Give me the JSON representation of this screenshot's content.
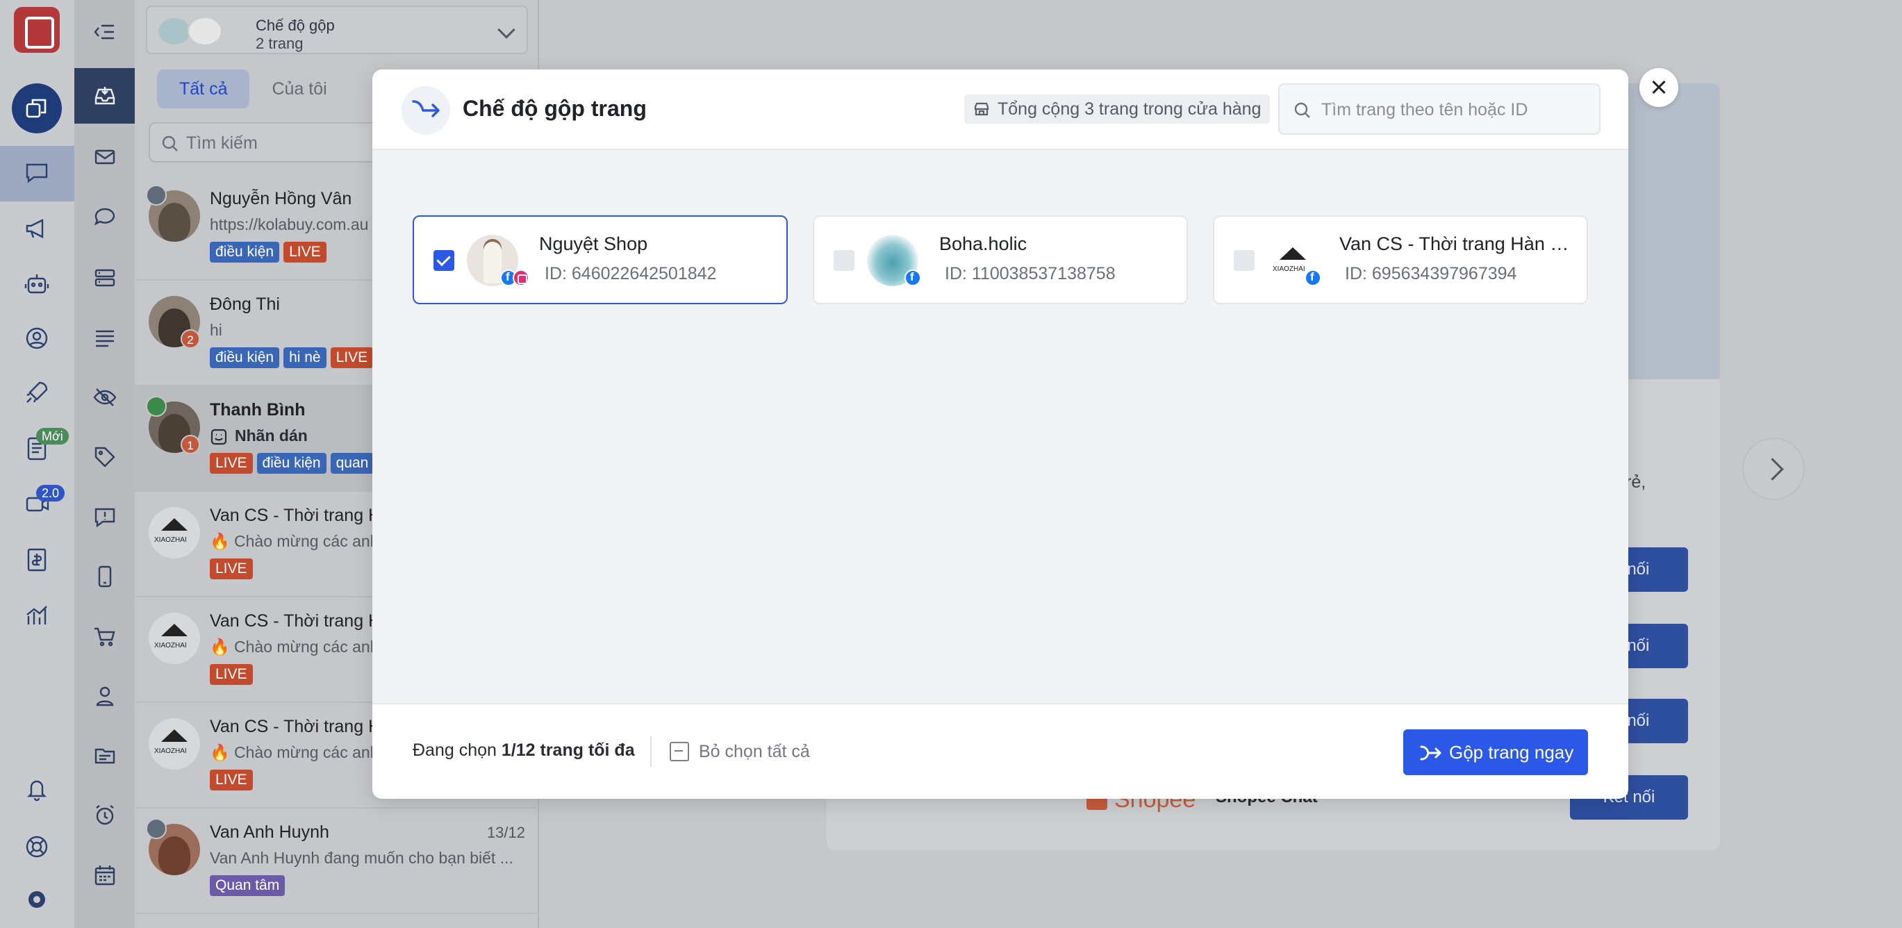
{
  "page_selector": {
    "title": "Chế độ gộp",
    "subtitle": "2 trang"
  },
  "tabs": [
    {
      "label": "Tất cả"
    },
    {
      "label": "Của tôi"
    }
  ],
  "search": {
    "placeholder": "Tìm kiếm"
  },
  "rail": {
    "badge_new": "Mới",
    "badge_version": "2.0"
  },
  "conversations": [
    {
      "name": "Nguyễn Hồng Vân",
      "message": "https://kolabuy.com.au",
      "tags": [
        {
          "text": "điều kiện",
          "color": "blue"
        },
        {
          "text": "LIVE",
          "color": "red"
        }
      ]
    },
    {
      "name": "Đông Thi",
      "message": "hi",
      "unread": "2",
      "tags": [
        {
          "text": "điều kiện",
          "color": "blue"
        },
        {
          "text": "hi nè",
          "color": "blue"
        },
        {
          "text": "LIVE",
          "color": "red"
        }
      ]
    },
    {
      "name": "Thanh Bình",
      "message": "Nhãn dán",
      "unread": "1",
      "tags": [
        {
          "text": "LIVE",
          "color": "red"
        },
        {
          "text": "điều kiện",
          "color": "blue"
        },
        {
          "text": "quan",
          "color": "blue"
        }
      ]
    },
    {
      "name": "Van CS - Thời trang H",
      "message": "🔥 Chào mừng các anh",
      "tags": [
        {
          "text": "LIVE",
          "color": "red"
        }
      ]
    },
    {
      "name": "Van CS - Thời trang H",
      "message": "🔥 Chào mừng các anh",
      "tags": [
        {
          "text": "LIVE",
          "color": "red"
        }
      ]
    },
    {
      "name": "Van CS - Thời trang H",
      "message": "🔥 Chào mừng các anh",
      "tags": [
        {
          "text": "LIVE",
          "color": "red"
        }
      ]
    },
    {
      "name": "Van Anh Huynh",
      "message": "Van Anh Huynh đang muốn cho bạn biết ...",
      "date": "13/12",
      "tags": [
        {
          "text": "Quan tâm",
          "color": "purple"
        }
      ]
    }
  ],
  "background": {
    "connect_label": "Kết nối",
    "connect_label_short": "ết nối",
    "text_e": "rẻ,",
    "shopee": "Shopee",
    "shopee_chat": "Shopee Chat"
  },
  "modal": {
    "title": "Chế độ gộp trang",
    "total": "Tổng cộng 3 trang trong cửa hàng",
    "search_placeholder": "Tìm trang theo tên hoặc ID",
    "pages": [
      {
        "name": "Nguyệt Shop",
        "id": "ID: 646022642501842",
        "selected": true,
        "platforms": [
          "facebook",
          "instagram"
        ]
      },
      {
        "name": "Boha.holic",
        "id": "ID: 110038537138758",
        "selected": false,
        "platforms": [
          "facebook"
        ]
      },
      {
        "name": "Van CS - Thời trang Hàn Q...",
        "id": "ID: 695634397967394",
        "selected": false,
        "platforms": [
          "facebook"
        ]
      }
    ],
    "footer": {
      "count_prefix": "Đang chọn",
      "count_value": "1/12 trang tối đa",
      "deselect": "Bỏ chọn tất cả",
      "merge_button": "Gộp trang ngay"
    }
  },
  "colors": {
    "primary": "#2c58e8",
    "live": "#c34a2c",
    "tag_blue": "#3a66b8",
    "tag_purple": "#6b5aa8"
  }
}
